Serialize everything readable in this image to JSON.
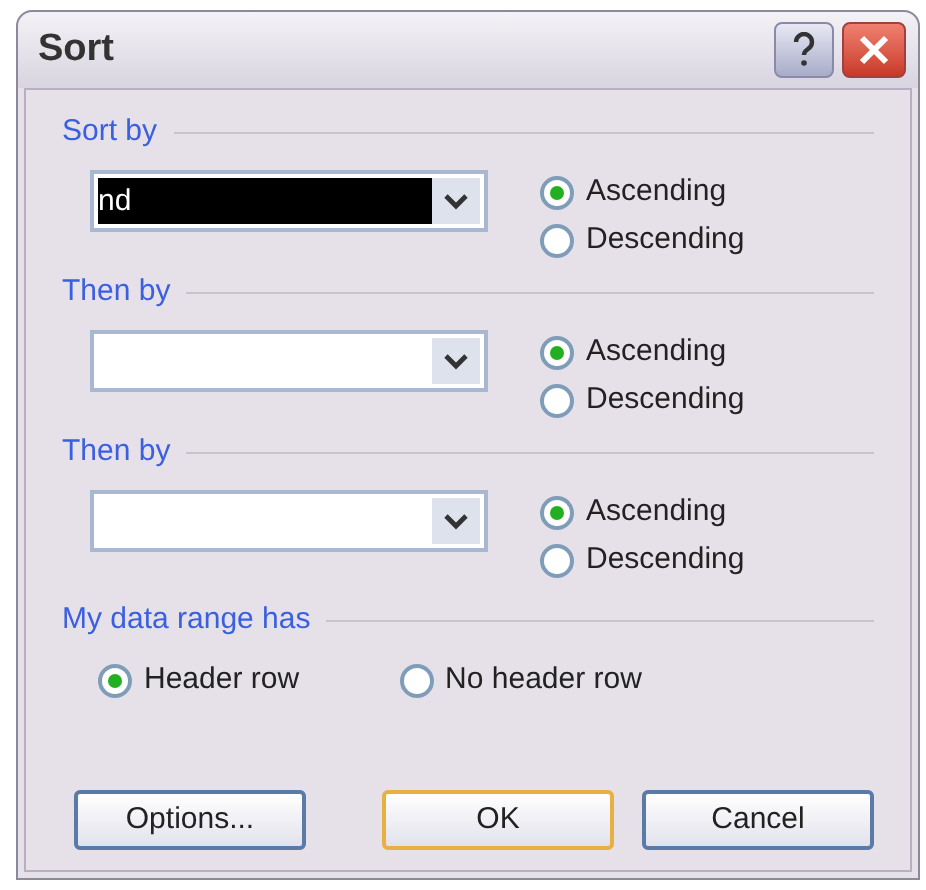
{
  "window": {
    "title": "Sort"
  },
  "groups": [
    {
      "label": "Sort by",
      "field": {
        "value": "nd",
        "highlighted": true
      },
      "options": [
        {
          "label": "Ascending",
          "selected": true
        },
        {
          "label": "Descending",
          "selected": false
        }
      ]
    },
    {
      "label": "Then by",
      "options": [
        {
          "label": "Ascending",
          "selected": true
        },
        {
          "label": "Descending",
          "selected": false
        }
      ]
    },
    {
      "label": "Then by",
      "options": [
        {
          "label": "Ascending",
          "selected": true
        },
        {
          "label": "Descending",
          "selected": false
        }
      ]
    }
  ],
  "header": {
    "label": "My data range has",
    "options": [
      {
        "label": "Header row",
        "selected": true
      },
      {
        "label": "No header row",
        "selected": false
      }
    ]
  },
  "buttons": [
    {
      "label": "Options...",
      "default": false
    },
    {
      "label": "OK",
      "default": true
    },
    {
      "label": "Cancel",
      "default": false
    }
  ]
}
